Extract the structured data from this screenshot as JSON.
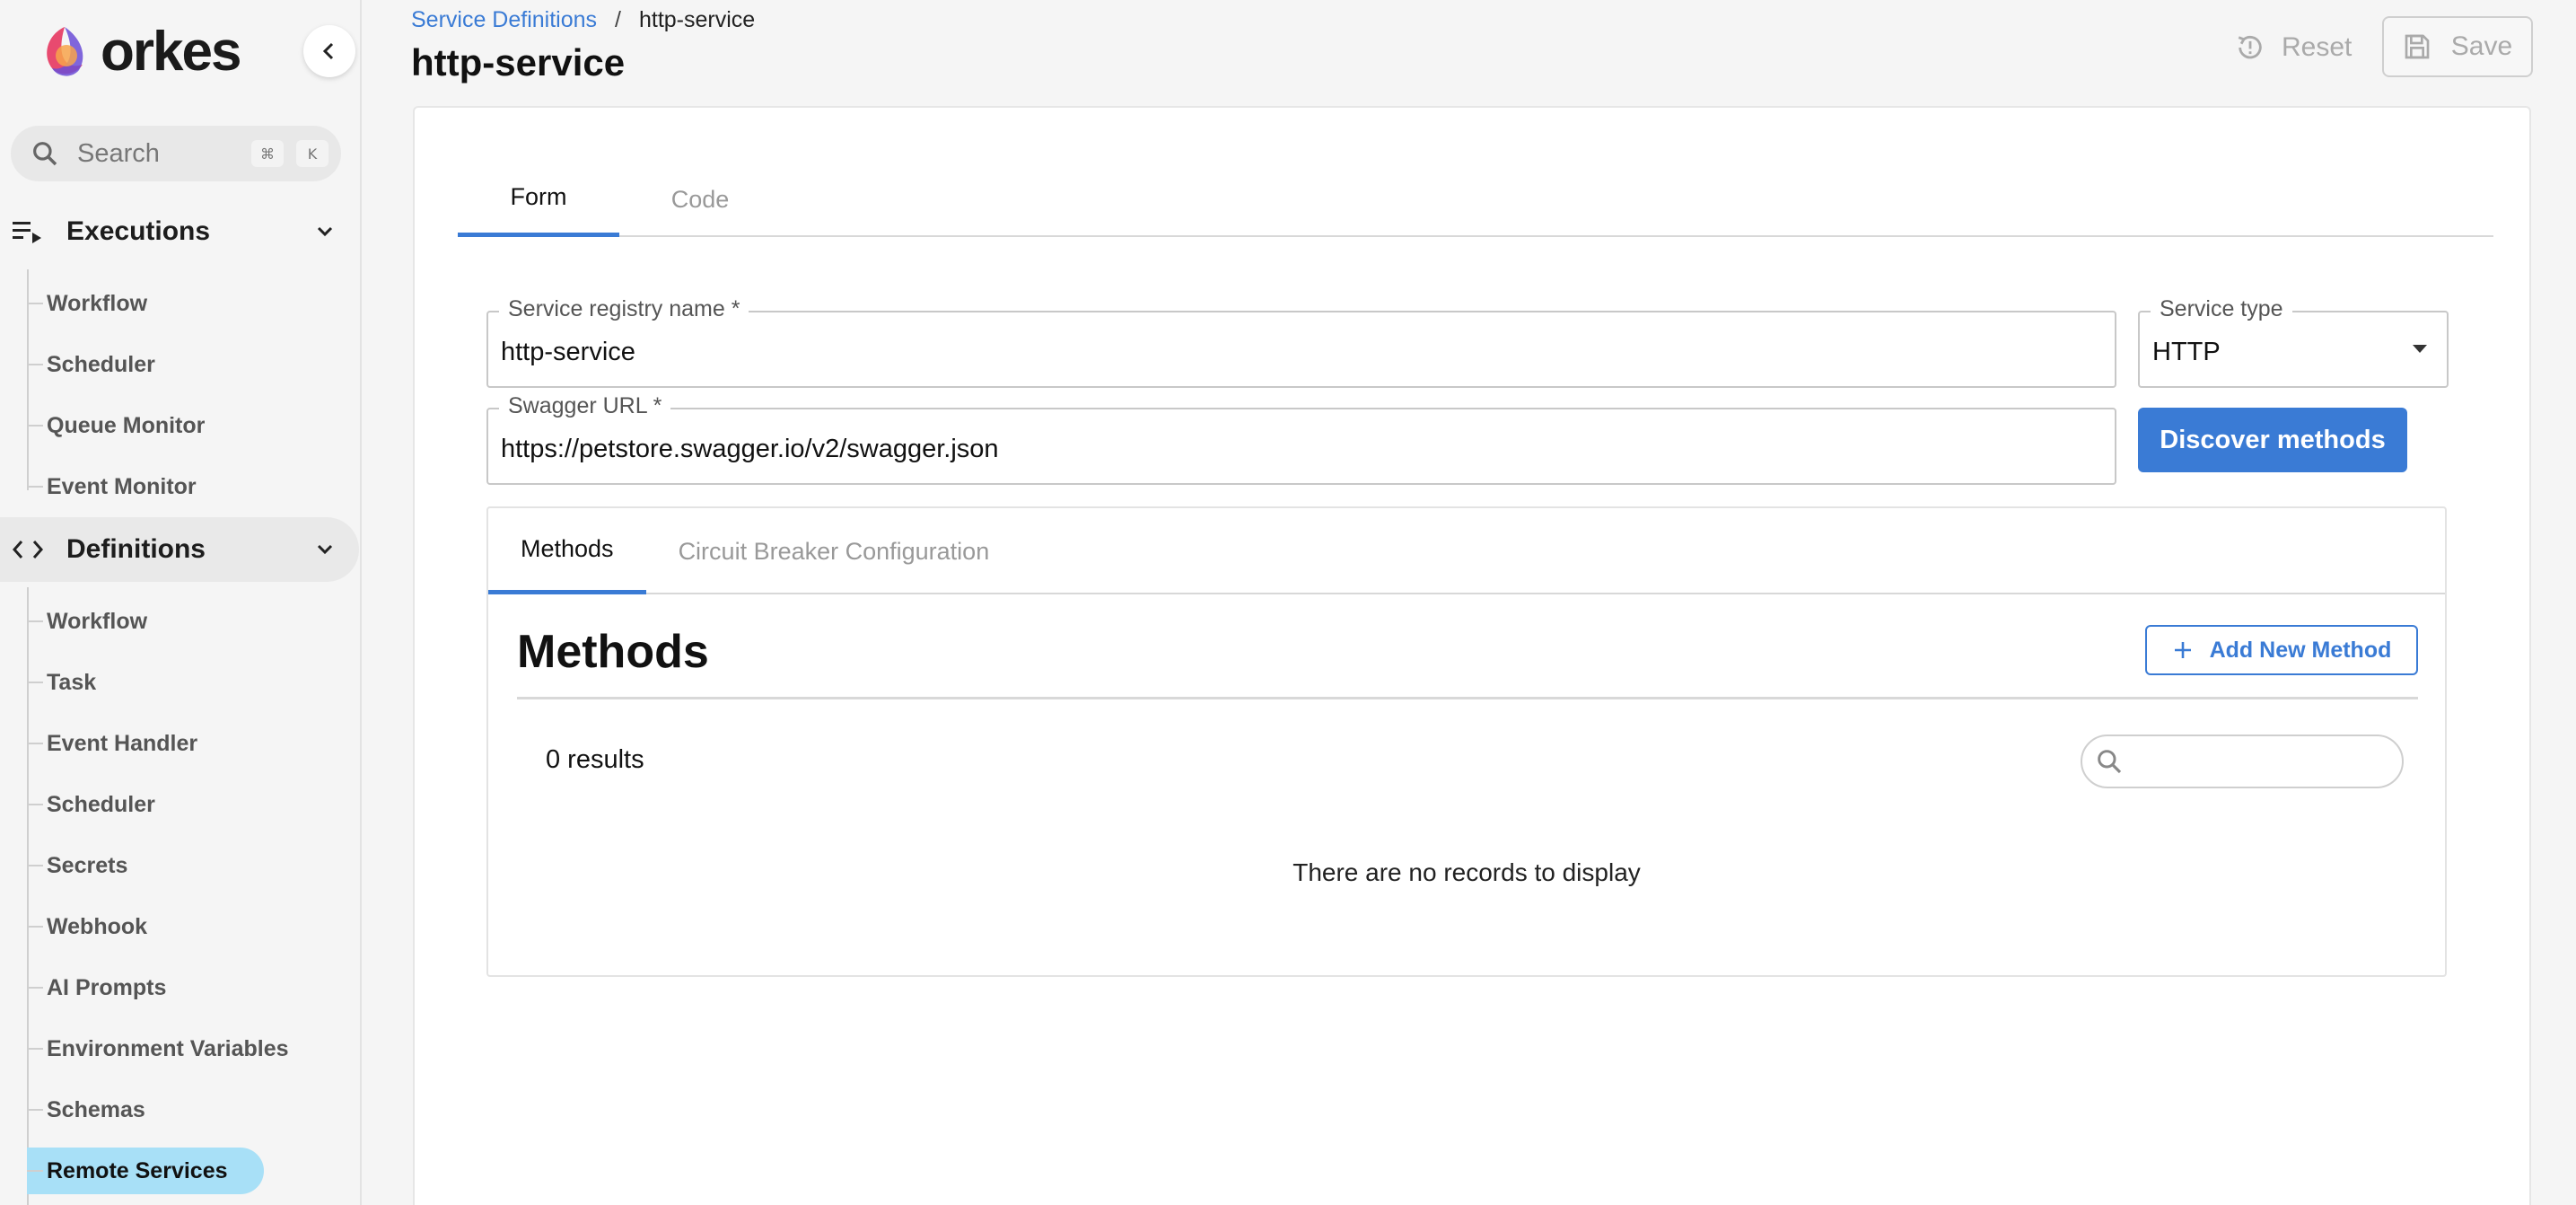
{
  "brand": {
    "name": "orkes"
  },
  "sidebar": {
    "search": {
      "placeholder": "Search",
      "key1": "⌘",
      "key2": "K"
    },
    "executions": {
      "label": "Executions",
      "items": [
        "Workflow",
        "Scheduler",
        "Queue Monitor",
        "Event Monitor"
      ]
    },
    "definitions": {
      "label": "Definitions",
      "items": [
        "Workflow",
        "Task",
        "Event Handler",
        "Scheduler",
        "Secrets",
        "Webhook",
        "AI Prompts",
        "Environment Variables",
        "Schemas",
        "Remote Services"
      ]
    }
  },
  "header": {
    "breadcrumb": {
      "parent": "Service Definitions",
      "separator": "/",
      "current": "http-service"
    },
    "title": "http-service",
    "reset_label": "Reset",
    "save_label": "Save"
  },
  "main": {
    "tabs": [
      "Form",
      "Code"
    ],
    "form": {
      "registry_label": "Service registry name",
      "registry_value": "http-service",
      "type_label": "Service type",
      "type_value": "HTTP",
      "swagger_label": "Swagger URL",
      "swagger_value": "https://petstore.swagger.io/v2/swagger.json",
      "required_mark": "*",
      "discover_label": "Discover methods"
    },
    "inner_tabs": [
      "Methods",
      "Circuit Breaker Configuration"
    ],
    "methods": {
      "title": "Methods",
      "add_label": "Add New Method",
      "results": "0 results",
      "empty": "There are no records to display"
    }
  },
  "colors": {
    "accent": "#3a7bd5",
    "selected_nav": "#a8e0f7"
  }
}
